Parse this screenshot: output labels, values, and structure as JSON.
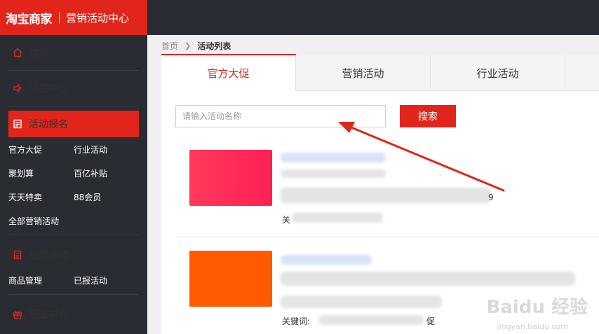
{
  "header": {
    "logo": "淘宝商家",
    "subtitle": "营销活动中心"
  },
  "sidebar": {
    "nav": [
      {
        "label": "首页",
        "icon": "home-icon"
      },
      {
        "label": "消息中心",
        "icon": "megaphone-icon"
      },
      {
        "label": "活动报名",
        "icon": "form-icon",
        "active": true
      },
      {
        "label": "已报活动",
        "icon": "document-icon"
      },
      {
        "label": "玩法中心",
        "icon": "gift-icon"
      }
    ],
    "activity_links": [
      "官方大促",
      "行业活动",
      "聚划算",
      "百亿补贴",
      "天天特卖",
      "88会员",
      "全部营销活动"
    ],
    "reported_links": [
      "商品管理",
      "已报活动"
    ]
  },
  "breadcrumb": {
    "home": "首页",
    "current": "活动列表"
  },
  "tabs": [
    "官方大促",
    "营销活动",
    "行业活动"
  ],
  "search": {
    "placeholder": "请输入活动名称",
    "button": "搜索"
  },
  "cards": [
    {
      "keyword_label": "关",
      "trailing_text": "9"
    },
    {
      "keyword_label": "关键词:",
      "trailing_text": "促"
    }
  ],
  "watermark": {
    "text": "Baidu 经验",
    "sub": "jingyan.baidu.com"
  },
  "colors": {
    "accent": "#e1251b",
    "sidebar_bg": "#2a2c34",
    "orange_thumb": "#ff5a00"
  }
}
